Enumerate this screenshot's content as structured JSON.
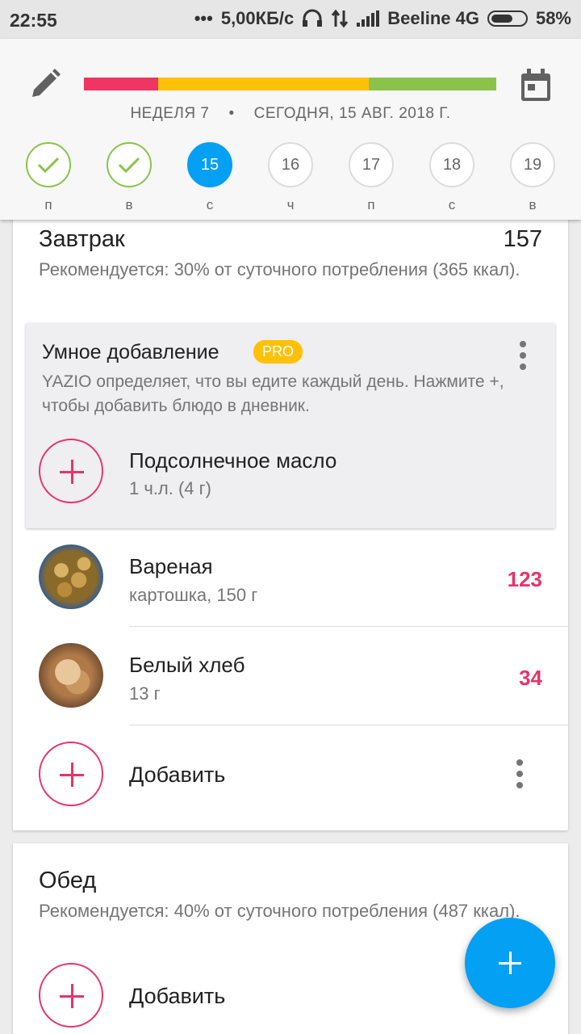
{
  "status_bar": {
    "time": "22:55",
    "dots": "•••",
    "speed": "5,00КБ/с",
    "carrier": "Beeline 4G",
    "battery": "58%"
  },
  "header": {
    "week_label": "НЕДЕЛЯ 7",
    "separator": "•",
    "date_label": "СЕГОДНЯ, 15 АВГ. 2018 Г.",
    "progress_colors": [
      "#ef3564",
      "#ffc107",
      "#8bc34a"
    ],
    "days": [
      {
        "number": "",
        "weekday": "п",
        "state": "done"
      },
      {
        "number": "",
        "weekday": "в",
        "state": "done"
      },
      {
        "number": "15",
        "weekday": "с",
        "state": "today"
      },
      {
        "number": "16",
        "weekday": "ч",
        "state": "future"
      },
      {
        "number": "17",
        "weekday": "п",
        "state": "future"
      },
      {
        "number": "18",
        "weekday": "с",
        "state": "future"
      },
      {
        "number": "19",
        "weekday": "в",
        "state": "future"
      }
    ]
  },
  "breakfast": {
    "title": "Завтрак",
    "kcal": "157",
    "recommendation": "Рекомендуется: 30% от суточного потребления (365 ккал).",
    "smart_add": {
      "title": "Умное добавление",
      "badge": "PRO",
      "description": "YAZIO определяет, что вы едите каждый день. Нажмите +, чтобы добавить блюдо в дневник.",
      "suggestion_name": "Подсолнечное масло",
      "suggestion_detail": "1 ч.л. (4 г)"
    },
    "items": [
      {
        "name": "Вареная",
        "detail": "картошка, 150 г",
        "kcal": "123",
        "icon": "boiled-potato-photo"
      },
      {
        "name": "Белый хлеб",
        "detail": "13 г",
        "kcal": "34",
        "icon": "white-bread-photo"
      }
    ],
    "add_label": "Добавить"
  },
  "lunch": {
    "title": "Обед",
    "recommendation": "Рекомендуется: 40% от суточного потребления (487 ккал).",
    "add_label": "Добавить"
  },
  "colors": {
    "accent_blue": "#03a0f4",
    "accent_pink": "#e8336a",
    "check_green": "#8bc34a",
    "pro_yellow": "#ffc107"
  }
}
